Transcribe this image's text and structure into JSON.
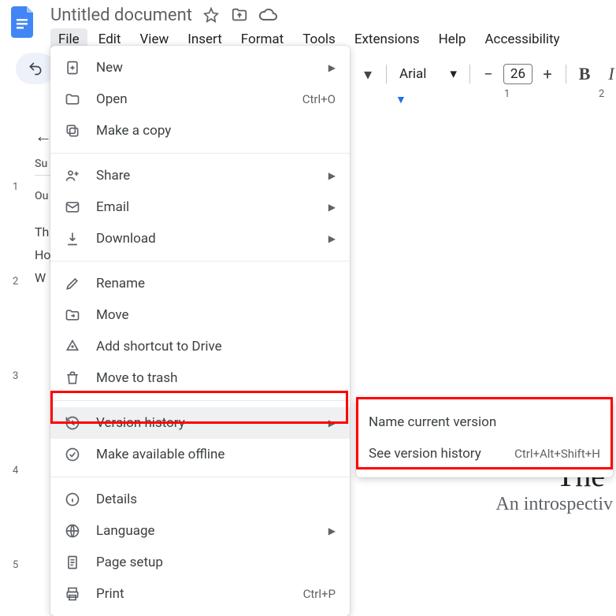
{
  "doc_title": "Untitled document",
  "menubar": [
    "File",
    "Edit",
    "View",
    "Insert",
    "Format",
    "Tools",
    "Extensions",
    "Help",
    "Accessibility"
  ],
  "toolbar": {
    "font": "Arial",
    "size": "26",
    "minus": "−",
    "plus": "+",
    "bold": "B",
    "italic": "I"
  },
  "ruler": {
    "t1": "1",
    "t2": "2"
  },
  "vruler": [
    "1",
    "2",
    "3",
    "4",
    "5"
  ],
  "outline": {
    "summary": "Su",
    "outline_label": "Ou",
    "items": [
      "Th",
      "Ho",
      "W"
    ]
  },
  "doc": {
    "h1": "The \u0000",
    "sub": "An introspectiv"
  },
  "menu": {
    "new": "New",
    "open": "Open",
    "open_sc": "Ctrl+O",
    "copy": "Make a copy",
    "share": "Share",
    "email": "Email",
    "download": "Download",
    "rename": "Rename",
    "move": "Move",
    "shortcut": "Add shortcut to Drive",
    "trash": "Move to trash",
    "version": "Version history",
    "offline": "Make available offline",
    "details": "Details",
    "language": "Language",
    "pagesetup": "Page setup",
    "print": "Print",
    "print_sc": "Ctrl+P"
  },
  "submenu": {
    "name": "Name current version",
    "see": "See version history",
    "see_sc": "Ctrl+Alt+Shift+H"
  }
}
